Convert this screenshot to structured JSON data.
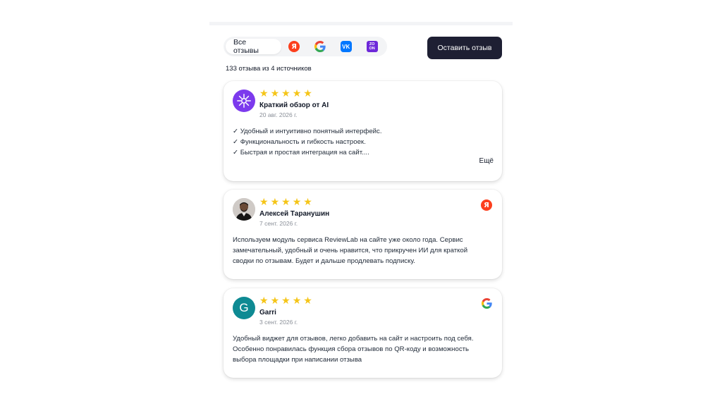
{
  "filters": {
    "all_label": "Все отзывы",
    "sources": [
      {
        "name": "yandex",
        "icon": "yandex-icon",
        "glyph": "Я",
        "color": "#fc3f1d"
      },
      {
        "name": "google",
        "icon": "google-icon",
        "color": "#4285f4"
      },
      {
        "name": "vk",
        "icon": "vk-icon",
        "glyph": "VK",
        "color": "#0077ff"
      },
      {
        "name": "zoon",
        "icon": "zoon-icon",
        "glyph": "ZO ON",
        "color": "#6d28d9"
      }
    ]
  },
  "leave_review_label": "Оставить отзыв",
  "summary": "133 отзыва из 4 источников",
  "reviews": [
    {
      "avatar_icon": "ai-avatar-icon",
      "rating": 5,
      "author": "Краткий обзор от AI",
      "date": "20 авг. 2026 г.",
      "lines": [
        "✓ Удобный и интуитивно понятный интерфейс.",
        "✓ Функциональность и гибкость настроек.",
        "✓ Быстрая и простая интеграция на сайт...."
      ],
      "more_label": "Ещё"
    },
    {
      "avatar_icon": "user-photo-avatar",
      "rating": 5,
      "author": "Алексей Таранушин",
      "date": "7 сент. 2026 г.",
      "source": "yandex",
      "lines": [
        "Используем модуль сервиса ReviewLab на сайте уже около года. Сервис",
        "замечательный, удобный и очень нравится, что прикручен ИИ для краткой",
        "сводки по отзывам. Будет и дальше продлевать подписку."
      ]
    },
    {
      "avatar_letter": "G",
      "avatar_color": "#0e8a93",
      "rating": 5,
      "author": "Garri",
      "date": "3 сент. 2026 г.",
      "source": "google",
      "lines": [
        "Удобный виджет для отзывов, легко добавить на сайт и настроить под себя.",
        "Особенно понравилась функция сбора отзывов по QR-коду и возможность",
        "выбора площадки при написании отзыва"
      ]
    }
  ],
  "star_glyph": "★",
  "colors": {
    "star": "#f5c518",
    "button_bg": "#1e1f33",
    "ai_avatar": "#7c3aed"
  }
}
